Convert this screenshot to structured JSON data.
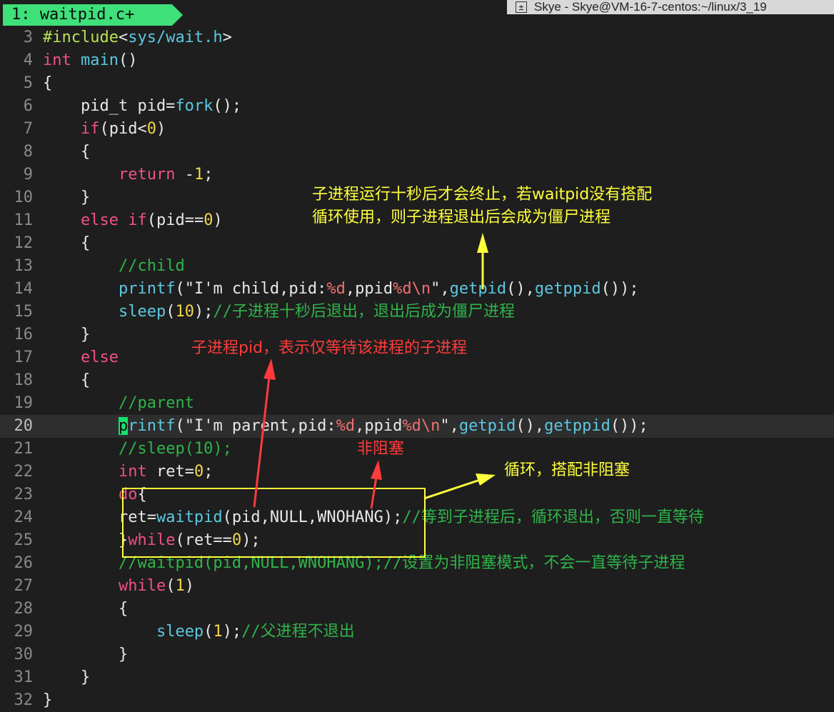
{
  "tab": {
    "label": "1: waitpid.c+"
  },
  "window_title": "Skye - Skye@VM-16-7-centos:~/linux/3_19",
  "editor": {
    "current_line": "20",
    "lines": [
      {
        "n": "3",
        "code": "#include<sys/wait.h>"
      },
      {
        "n": "4",
        "code": "int main()"
      },
      {
        "n": "5",
        "code": "{"
      },
      {
        "n": "6",
        "code": "    pid_t pid=fork();"
      },
      {
        "n": "7",
        "code": "    if(pid<0)"
      },
      {
        "n": "8",
        "code": "    {"
      },
      {
        "n": "9",
        "code": "        return -1;"
      },
      {
        "n": "10",
        "code": "    }"
      },
      {
        "n": "11",
        "code": "    else if(pid==0)"
      },
      {
        "n": "12",
        "code": "    {"
      },
      {
        "n": "13",
        "code": "        //child"
      },
      {
        "n": "14",
        "code": "        printf(\"I'm child,pid:%d,ppid%d\\n\",getpid(),getppid());"
      },
      {
        "n": "15",
        "code": "        sleep(10);//子进程十秒后退出，退出后成为僵尸进程"
      },
      {
        "n": "16",
        "code": "    }"
      },
      {
        "n": "17",
        "code": "    else"
      },
      {
        "n": "18",
        "code": "    {"
      },
      {
        "n": "19",
        "code": "        //parent"
      },
      {
        "n": "20",
        "code": "        printf(\"I'm parent,pid:%d,ppid%d\\n\",getpid(),getppid());"
      },
      {
        "n": "21",
        "code": "        //sleep(10);"
      },
      {
        "n": "22",
        "code": "        int ret=0;"
      },
      {
        "n": "23",
        "code": "        do{"
      },
      {
        "n": "24",
        "code": "        ret=waitpid(pid,NULL,WNOHANG);//等到子进程后，循环退出，否则一直等待"
      },
      {
        "n": "25",
        "code": "        }while(ret==0);"
      },
      {
        "n": "26",
        "code": "        //waitpid(pid,NULL,WNOHANG);//设置为非阻塞模式，不会一直等待子进程"
      },
      {
        "n": "27",
        "code": "        while(1)"
      },
      {
        "n": "28",
        "code": "        {"
      },
      {
        "n": "29",
        "code": "            sleep(1);//父进程不退出"
      },
      {
        "n": "30",
        "code": "        }"
      },
      {
        "n": "31",
        "code": "    }"
      },
      {
        "n": "32",
        "code": "}"
      }
    ]
  },
  "annotations": {
    "zombie_note_line1": "子进程运行十秒后才会终止，若waitpid没有搭配",
    "zombie_note_line2": "循环使用，则子进程退出后会成为僵尸进程",
    "pid_note": "子进程pid，表示仅等待该进程的子进程",
    "nonblock_note": "非阻塞",
    "loop_note": "循环，搭配非阻塞",
    "colors": {
      "yellow": "#ffff3c",
      "red": "#ff3b3b"
    }
  }
}
